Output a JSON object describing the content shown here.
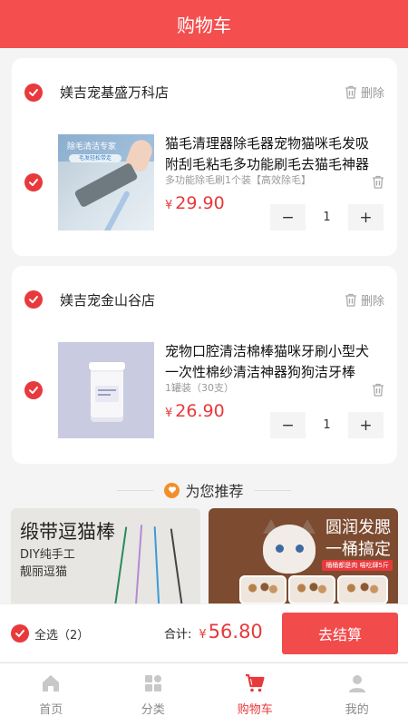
{
  "header": {
    "title": "购物车"
  },
  "stores": [
    {
      "name": "媄吉宠基盛万科店",
      "delete_label": "删除",
      "item": {
        "title": "猫毛清理器除毛器宠物猫咪毛发吸附刮毛粘毛多功能刷毛去猫毛神器",
        "spec": "多功能除毛刷1个装【高效除毛】",
        "currency": "¥",
        "price": "29.90",
        "quantity": "1",
        "image_text": {
          "title": "除毛清洁专家",
          "sub": "毛发轻松带走"
        }
      }
    },
    {
      "name": "媄吉宠金山谷店",
      "delete_label": "删除",
      "item": {
        "title": "宠物口腔清洁棉棒猫咪牙刷小型犬一次性棉纱清洁神器狗狗洁牙棒",
        "spec": "1罐装（30支）",
        "currency": "¥",
        "price": "26.90",
        "quantity": "1"
      }
    }
  ],
  "recommend": {
    "label": "为您推荐",
    "cards": [
      {
        "title": "缎带逗猫棒",
        "sub1": "DIY纯手工",
        "sub2": "靓丽逗猫"
      },
      {
        "title1": "圆润发腮",
        "title2": "一桶搞定",
        "badge": "桶桶都是肉 喵吃肆5斤"
      }
    ]
  },
  "checkout": {
    "select_all": "全选（2）",
    "total_label": "合计:",
    "currency": "¥",
    "total": "56.80",
    "pay_button": "去结算"
  },
  "tabs": [
    {
      "label": "首页",
      "icon": "home-icon"
    },
    {
      "label": "分类",
      "icon": "category-icon"
    },
    {
      "label": "购物车",
      "icon": "cart-icon",
      "active": true
    },
    {
      "label": "我的",
      "icon": "profile-icon"
    }
  ],
  "colors": {
    "primary": "#e8393d",
    "header": "#f44e4e",
    "recommend_icon": "#f28f2b"
  }
}
